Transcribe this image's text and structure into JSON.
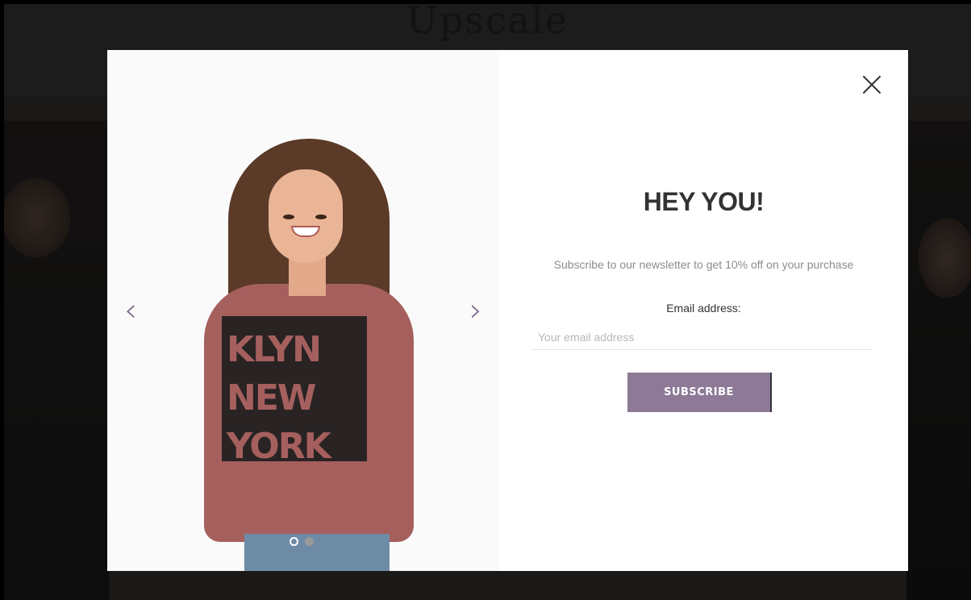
{
  "background": {
    "logo_text": "Upscale"
  },
  "modal": {
    "slider": {
      "prev_icon": "chevron-left-icon",
      "next_icon": "chevron-right-icon",
      "prev_glyph": "‹",
      "next_glyph": "›",
      "print_text": "KLYN NEW YORK OOKLY",
      "dots": [
        {
          "state": "active"
        },
        {
          "state": "inactive"
        }
      ]
    },
    "close_icon": "close-icon",
    "title": "HEY YOU!",
    "subtitle": "Subscribe to our newsletter to get 10% off on your purchase",
    "email_label": "Email address:",
    "email_placeholder": "Your email address",
    "email_value": "",
    "subscribe_label": "SUBSCRIBE"
  },
  "colors": {
    "accent_button": "#8d7a97",
    "arrow": "#7d6a8c",
    "title_text": "#333333",
    "subtitle_text": "#8c8c8c"
  }
}
